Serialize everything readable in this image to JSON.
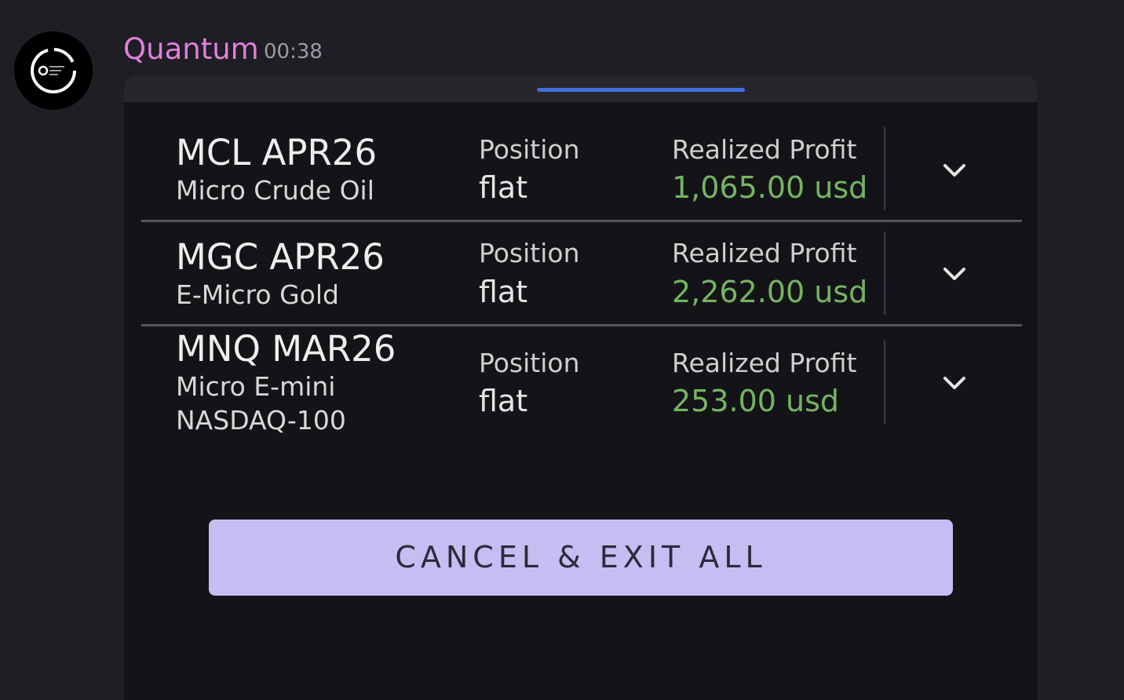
{
  "message": {
    "author": "Quantum",
    "timestamp": "00:38",
    "avatar_icon": "quantum-logo-icon"
  },
  "embed": {
    "positions": [
      {
        "symbol": "MCL APR26",
        "description": "Micro Crude Oil",
        "position_label": "Position",
        "position_value": "flat",
        "profit_label": "Realized Profit",
        "profit_value": "1,065.00 usd",
        "expand_icon": "chevron-down-icon"
      },
      {
        "symbol": "MGC APR26",
        "description": "E-Micro Gold",
        "position_label": "Position",
        "position_value": "flat",
        "profit_label": "Realized Profit",
        "profit_value": "2,262.00 usd",
        "expand_icon": "chevron-down-icon"
      },
      {
        "symbol": "MNQ MAR26",
        "description": "Micro E-mini NASDAQ-100",
        "position_label": "Position",
        "position_value": "flat",
        "profit_label": "Realized Profit",
        "profit_value": "253.00 usd",
        "expand_icon": "chevron-down-icon"
      }
    ],
    "cancel_button_label": "CANCEL & EXIT ALL"
  },
  "colors": {
    "background": "#1e1e24",
    "author": "#e07fdc",
    "profit": "#74b561",
    "button": "#c8bdf2",
    "tab_indicator": "#3f6fe0"
  }
}
